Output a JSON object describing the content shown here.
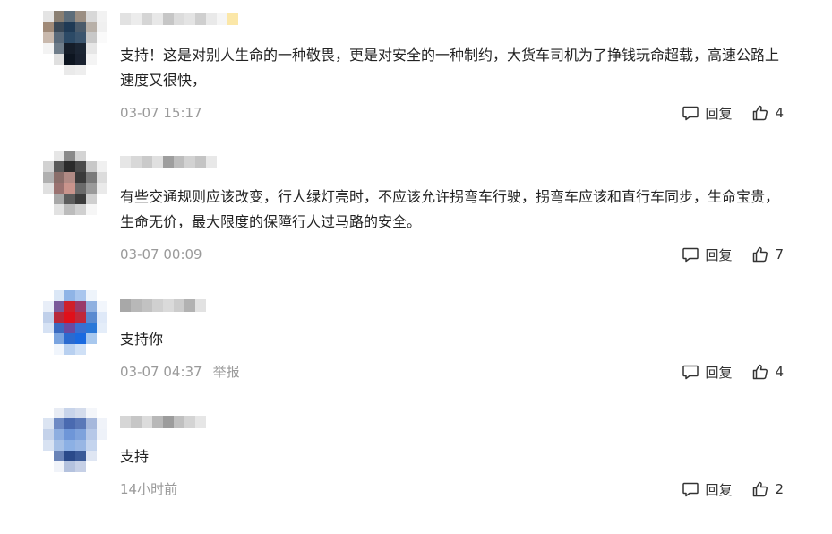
{
  "ui": {
    "reply_label": "回复",
    "report_label": "举报"
  },
  "comments": [
    {
      "text": "支持！这是对别人生命的一种敬畏，更是对安全的一种制约，大货车司机为了挣钱玩命超载，高速公路上速度又很快，",
      "time": "03-07 15:17",
      "likes": "4",
      "show_report": false
    },
    {
      "text": "有些交通规则应该改变，行人绿灯亮时，不应该允许拐弯车行驶，拐弯车应该和直行车同步，生命宝贵，生命无价，最大限度的保障行人过马路的安全。",
      "time": "03-07 00:09",
      "likes": "7",
      "show_report": false
    },
    {
      "text": "支持你",
      "time": "03-07 04:37",
      "likes": "4",
      "show_report": true
    },
    {
      "text": "支持",
      "time": "14小时前",
      "likes": "2",
      "show_report": false
    }
  ],
  "icons": {
    "reply": "comment-bubble-icon",
    "like": "thumbs-up-icon"
  },
  "colors": {
    "meta_text": "#9a9a9a",
    "body_text": "#222222"
  }
}
